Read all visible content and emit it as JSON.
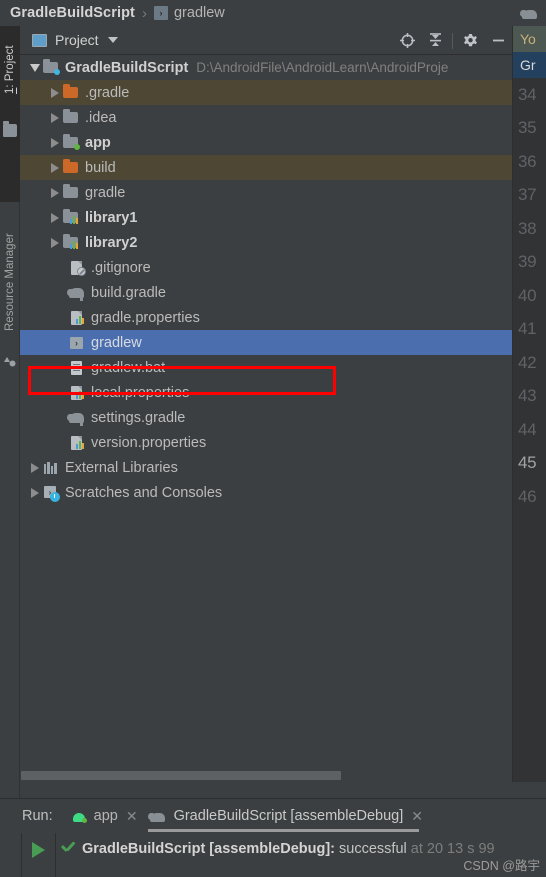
{
  "breadcrumb": {
    "root": "GradleBuildScript",
    "separator": "›",
    "leaf": "gradlew",
    "leaf_icon": "script-file-icon",
    "leaf_icon_glyph": "›"
  },
  "tool_strip": {
    "tabs": [
      {
        "label_prefix": "1",
        "label": ": Project",
        "icon": "project-icon",
        "active": true
      },
      {
        "label": "Resource Manager",
        "icon": "resource-manager-icon",
        "active": false
      }
    ]
  },
  "project_panel": {
    "title": "Project",
    "title_icon": "project-view-icon",
    "dropdown_icon": "chevron-down-icon",
    "tools": [
      {
        "name": "locate-icon",
        "title": "Select Opened File"
      },
      {
        "name": "collapse-all-icon",
        "title": "Collapse All"
      },
      {
        "name": "gear-icon",
        "title": "Settings"
      },
      {
        "name": "minimize-icon",
        "title": "Hide"
      }
    ],
    "tree": [
      {
        "label": "GradleBuildScript",
        "subpath": "D:\\AndroidFile\\AndroidLearn\\AndroidProje",
        "depth": 0,
        "arrow": "open",
        "icon": "module-folder-icon",
        "bold": true,
        "state": "normal"
      },
      {
        "label": ".gradle",
        "depth": 1,
        "arrow": "closed",
        "icon": "folder-orange-icon",
        "bold": false,
        "state": "excluded"
      },
      {
        "label": ".idea",
        "depth": 1,
        "arrow": "closed",
        "icon": "folder-gray-icon",
        "bold": false,
        "state": "normal"
      },
      {
        "label": "app",
        "depth": 1,
        "arrow": "closed",
        "icon": "module-android-icon",
        "bold": true,
        "state": "normal"
      },
      {
        "label": "build",
        "depth": 1,
        "arrow": "closed",
        "icon": "folder-orange-icon",
        "bold": false,
        "state": "excluded"
      },
      {
        "label": "gradle",
        "depth": 1,
        "arrow": "closed",
        "icon": "folder-gray-icon",
        "bold": false,
        "state": "normal"
      },
      {
        "label": "library1",
        "depth": 1,
        "arrow": "closed",
        "icon": "module-library-icon",
        "bold": true,
        "state": "normal"
      },
      {
        "label": "library2",
        "depth": 1,
        "arrow": "closed",
        "icon": "module-library-icon",
        "bold": true,
        "state": "normal"
      },
      {
        "label": ".gitignore",
        "depth": 1,
        "arrow": "none",
        "icon": "gitignore-file-icon",
        "bold": false,
        "state": "normal"
      },
      {
        "label": "build.gradle",
        "depth": 1,
        "arrow": "none",
        "icon": "gradle-elephant-icon",
        "bold": false,
        "state": "normal"
      },
      {
        "label": "gradle.properties",
        "depth": 1,
        "arrow": "none",
        "icon": "properties-file-icon",
        "bold": false,
        "state": "normal"
      },
      {
        "label": "gradlew",
        "depth": 1,
        "arrow": "none",
        "icon": "script-file-icon",
        "bold": false,
        "state": "selected"
      },
      {
        "label": "gradlew.bat",
        "depth": 1,
        "arrow": "none",
        "icon": "bat-file-icon",
        "bold": false,
        "state": "normal"
      },
      {
        "label": "local.properties",
        "depth": 1,
        "arrow": "none",
        "icon": "properties-file-icon",
        "bold": false,
        "state": "normal"
      },
      {
        "label": "settings.gradle",
        "depth": 1,
        "arrow": "none",
        "icon": "gradle-elephant-icon",
        "bold": false,
        "state": "normal"
      },
      {
        "label": "version.properties",
        "depth": 1,
        "arrow": "none",
        "icon": "properties-file-icon",
        "bold": false,
        "state": "normal"
      },
      {
        "label": "External Libraries",
        "depth": 0,
        "arrow": "closed",
        "icon": "external-libraries-icon",
        "bold": false,
        "state": "normal"
      },
      {
        "label": "Scratches and Consoles",
        "depth": 0,
        "arrow": "closed",
        "icon": "scratches-icon",
        "bold": false,
        "state": "normal"
      }
    ]
  },
  "annotation": {
    "color": "#ff0000",
    "target": "gradlew"
  },
  "editor_strip": {
    "corner_icon": "gradle-elephant-icon",
    "tabs": [
      {
        "label": "Yo",
        "selected": false
      },
      {
        "label": "Gr",
        "selected": true
      }
    ],
    "line_numbers": [
      "34",
      "35",
      "36",
      "37",
      "38",
      "39",
      "40",
      "41",
      "42",
      "43",
      "44",
      "45",
      "46"
    ],
    "current_line": "45"
  },
  "run_panel": {
    "label": "Run:",
    "tabs": [
      {
        "name": "app",
        "icon": "android-icon",
        "close_glyph": "✕",
        "active": false
      },
      {
        "name": "GradleBuildScript [assembleDebug]",
        "icon": "gradle-elephant-icon",
        "close_glyph": "✕",
        "active": true
      }
    ],
    "rerun_icon": "play-icon",
    "status_icon": "check-icon",
    "console": {
      "task": "GradleBuildScript [assembleDebug]:",
      "result": "successful",
      "timing": "at 20 13 s 99"
    }
  },
  "watermark": "CSDN @路宇",
  "colors": {
    "bg": "#3c3f41",
    "selection": "#4b6eaf",
    "excluded": "#4e4733",
    "gutter": "#313335",
    "annotation": "#ff0000",
    "success": "#499c54",
    "tab_selected": "#24405f"
  }
}
